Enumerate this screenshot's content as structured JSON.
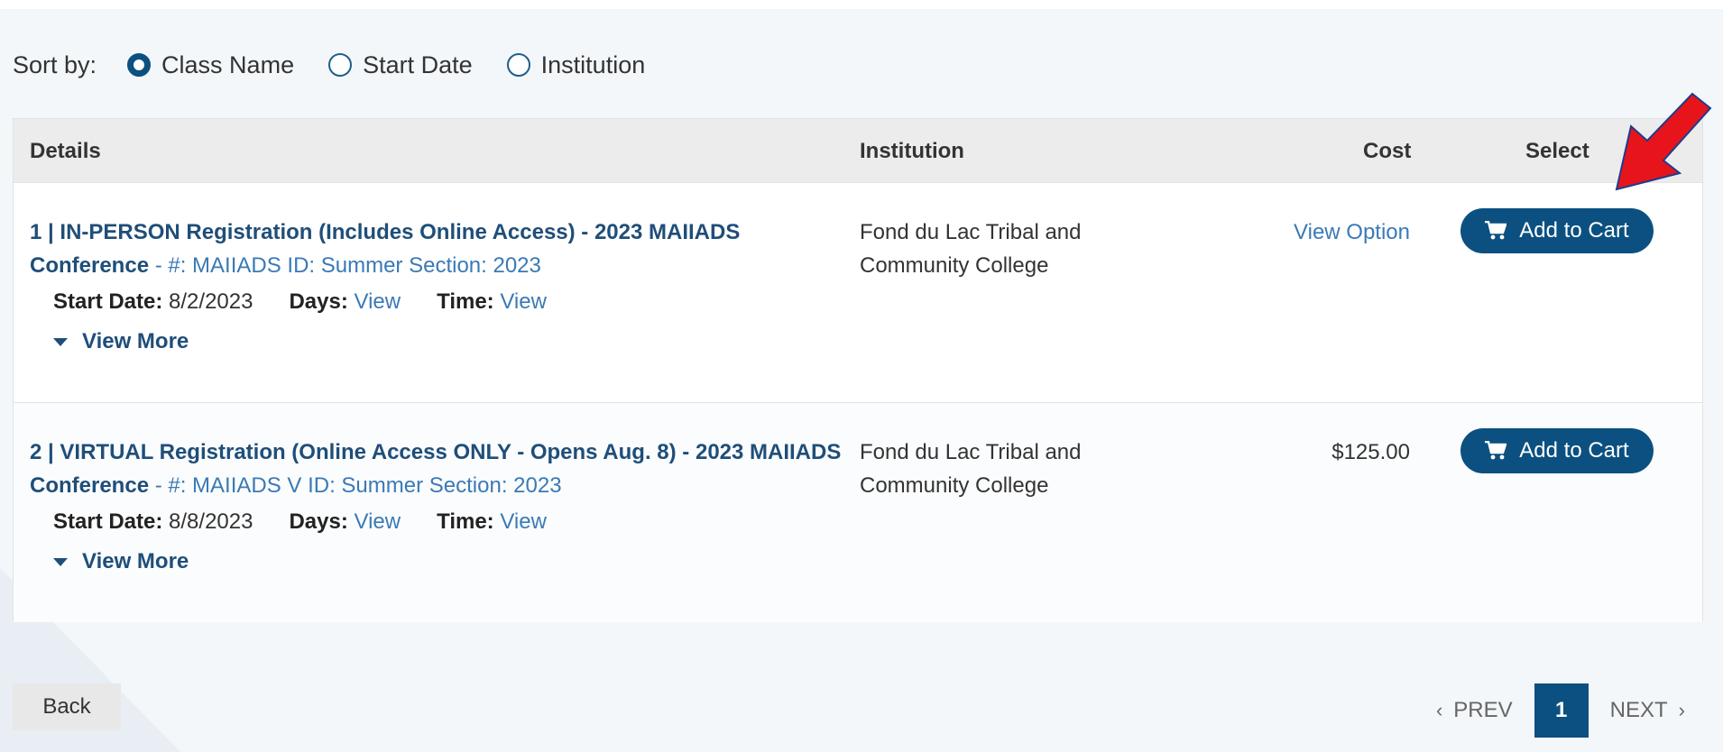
{
  "sort": {
    "label": "Sort by:",
    "options": [
      {
        "label": "Class Name",
        "checked": true
      },
      {
        "label": "Start Date",
        "checked": false
      },
      {
        "label": "Institution",
        "checked": false
      }
    ]
  },
  "table": {
    "headers": {
      "details": "Details",
      "institution": "Institution",
      "cost": "Cost",
      "select": "Select"
    },
    "rows": [
      {
        "title": "1 | IN-PERSON Registration (Includes Online Access) - 2023 MAIIADS Conference",
        "meta": " - #: MAIIADS  ID: Summer  Section: 2023",
        "start_label": "Start Date:",
        "start_value": "8/2/2023",
        "days_label": "Days:",
        "days_link": "View",
        "time_label": "Time:",
        "time_link": "View",
        "view_more": "View More",
        "institution": "Fond du Lac Tribal and Community College",
        "cost": "View Option",
        "cart_label": "Add to Cart"
      },
      {
        "title": "2 | VIRTUAL Registration (Online Access ONLY - Opens Aug. 8) - 2023 MAIIADS Conference",
        "meta": " - #: MAIIADS V  ID: Summer  Section: 2023",
        "start_label": "Start Date:",
        "start_value": "8/8/2023",
        "days_label": "Days:",
        "days_link": "View",
        "time_label": "Time:",
        "time_link": "View",
        "view_more": "View More",
        "institution": "Fond du Lac Tribal and Community College",
        "cost": "$125.00",
        "cart_label": "Add to Cart"
      }
    ]
  },
  "footer": {
    "back_label": "Back",
    "prev_label": "PREV",
    "current_page": "1",
    "next_label": "NEXT"
  },
  "colors": {
    "primary": "#0b5080",
    "link": "#3a7ab5",
    "annotation_arrow": "#e8141b"
  }
}
